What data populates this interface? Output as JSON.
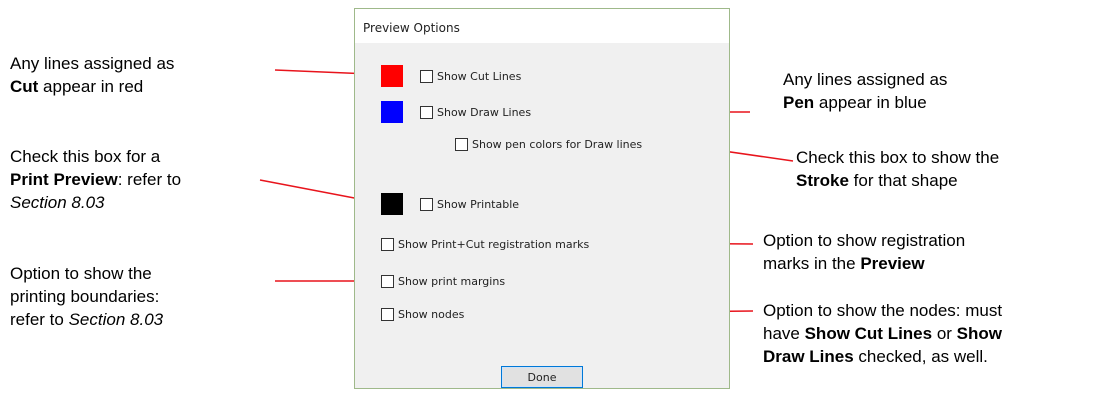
{
  "dialog": {
    "title": "Preview Options",
    "options": {
      "cut": "Show Cut Lines",
      "draw": "Show Draw Lines",
      "pen_colors": "Show pen colors for Draw lines",
      "printable": "Show Printable",
      "reg_marks": "Show Print+Cut registration marks",
      "print_margins": "Show print margins",
      "nodes": "Show nodes"
    },
    "swatch_colors": {
      "cut": "#ff0000",
      "draw": "#0000ff",
      "printable": "#000000"
    },
    "done_label": "Done"
  },
  "annotations": {
    "cut": {
      "line1": "Any lines assigned as",
      "bold": "Cut",
      "rest": " appear in red"
    },
    "print_preview": {
      "line1": "Check this box for a",
      "bold": "Print Preview",
      "rest": ": refer to",
      "italic": "Section 8.03"
    },
    "boundaries": {
      "line1": "Option to show the",
      "line2": "printing boundaries:",
      "prefix": "refer to ",
      "italic": "Section 8.03"
    },
    "pen": {
      "line1": "Any lines assigned as",
      "bold": "Pen",
      "rest": " appear in blue"
    },
    "stroke": {
      "line1": "Check this box to show the",
      "bold": "Stroke",
      "rest": " for that shape"
    },
    "registration": {
      "line1": "Option to show registration",
      "prefix": "marks in the ",
      "bold": "Preview"
    },
    "nodes": {
      "line1": "Option to show the nodes: must",
      "prefix": "have ",
      "bold1": "Show Cut Lines",
      "mid": " or ",
      "bold2": "Show",
      "bold3": "Draw Lines",
      "rest": " checked, as well."
    }
  },
  "colors": {
    "arrow": "#e8141c",
    "dialog_border": "#9fb98a",
    "button_border": "#0078d7"
  }
}
